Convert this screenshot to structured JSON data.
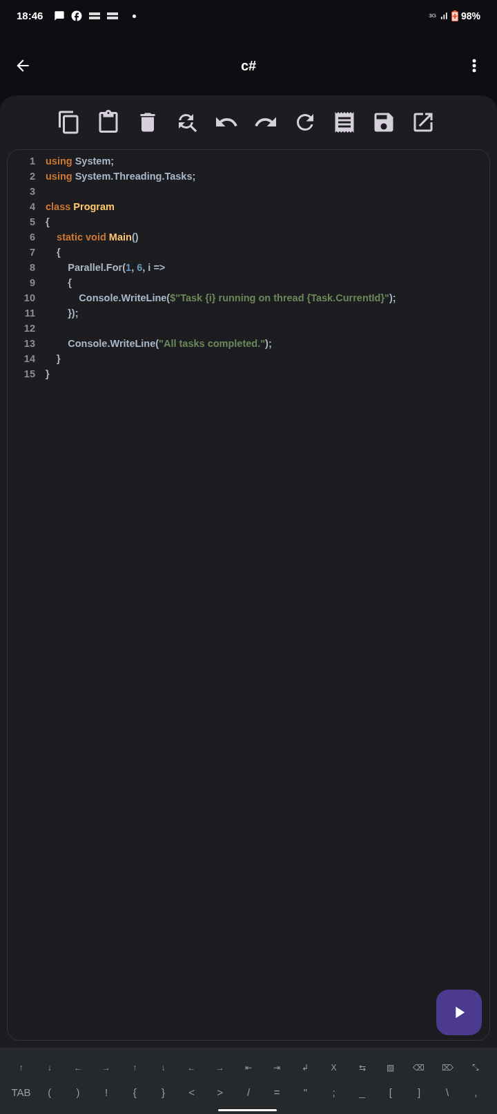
{
  "status_bar": {
    "time": "18:46",
    "network": "3G",
    "battery": "98%"
  },
  "header": {
    "title": "c#"
  },
  "toolbar": [
    {
      "kind": "copy"
    },
    {
      "kind": "paste"
    },
    {
      "kind": "delete"
    },
    {
      "kind": "find_replace"
    },
    {
      "kind": "undo"
    },
    {
      "kind": "redo"
    },
    {
      "kind": "reload"
    },
    {
      "kind": "receipt"
    },
    {
      "kind": "save"
    },
    {
      "kind": "open"
    }
  ],
  "editor": {
    "lines": [
      {
        "number": "1",
        "tokens": [
          {
            "kind": "keyword",
            "text": "using"
          },
          {
            "kind": "plain",
            "text": " System;"
          }
        ]
      },
      {
        "number": "2",
        "tokens": [
          {
            "kind": "keyword",
            "text": "using"
          },
          {
            "kind": "plain",
            "text": " System.Threading.Tasks;"
          }
        ]
      },
      {
        "number": "3"
      },
      {
        "number": "4",
        "tokens": [
          {
            "kind": "keyword",
            "text": "class"
          },
          {
            "kind": "name",
            "text": " Program"
          }
        ]
      },
      {
        "number": "5",
        "tokens": [
          {
            "kind": "plain",
            "text": "{"
          }
        ]
      },
      {
        "number": "6",
        "tokens": [
          {
            "kind": "keyword",
            "text": "    static void"
          },
          {
            "kind": "name",
            "text": " Main"
          },
          {
            "kind": "plain",
            "text": "()"
          }
        ]
      },
      {
        "number": "7",
        "tokens": [
          {
            "kind": "plain",
            "text": "    {"
          }
        ]
      },
      {
        "number": "8",
        "tokens": [
          {
            "kind": "plain",
            "text": "        Parallel.For("
          },
          {
            "kind": "number",
            "text": "1"
          },
          {
            "kind": "plain",
            "text": ", "
          },
          {
            "kind": "number",
            "text": "6"
          },
          {
            "kind": "plain",
            "text": ", i =>"
          }
        ]
      },
      {
        "number": "9",
        "tokens": [
          {
            "kind": "plain",
            "text": "        {"
          }
        ]
      },
      {
        "number": "10",
        "tokens": [
          {
            "kind": "plain",
            "text": "            Console.WriteLine("
          },
          {
            "kind": "string",
            "text": "$\"Task {i} running on thread {Task.CurrentId}\""
          },
          {
            "kind": "plain",
            "text": ");"
          }
        ]
      },
      {
        "number": "11",
        "tokens": [
          {
            "kind": "plain",
            "text": "        });"
          }
        ]
      },
      {
        "number": "12"
      },
      {
        "number": "13",
        "tokens": [
          {
            "kind": "plain",
            "text": "        Console.WriteLine("
          },
          {
            "kind": "string",
            "text": "\"All tasks completed.\""
          },
          {
            "kind": "plain",
            "text": ");"
          }
        ]
      },
      {
        "number": "14",
        "tokens": [
          {
            "kind": "plain",
            "text": "    }"
          }
        ]
      },
      {
        "number": "15",
        "tokens": [
          {
            "kind": "plain",
            "text": "}"
          }
        ]
      }
    ]
  },
  "keyboard": {
    "rows": [
      [
        "↑",
        "↓",
        "←",
        "→",
        "↑",
        "↓",
        "←",
        "→",
        "⇤",
        "⇥",
        "↲",
        "X",
        "⇆",
        "▧",
        "⌫",
        "⌦",
        "⤡"
      ],
      [
        "TAB",
        "(",
        ")",
        "!",
        "{",
        "}",
        "<",
        ">",
        "/",
        "=",
        "\"",
        ";",
        "_",
        "[",
        "]",
        "\\",
        ","
      ]
    ]
  }
}
